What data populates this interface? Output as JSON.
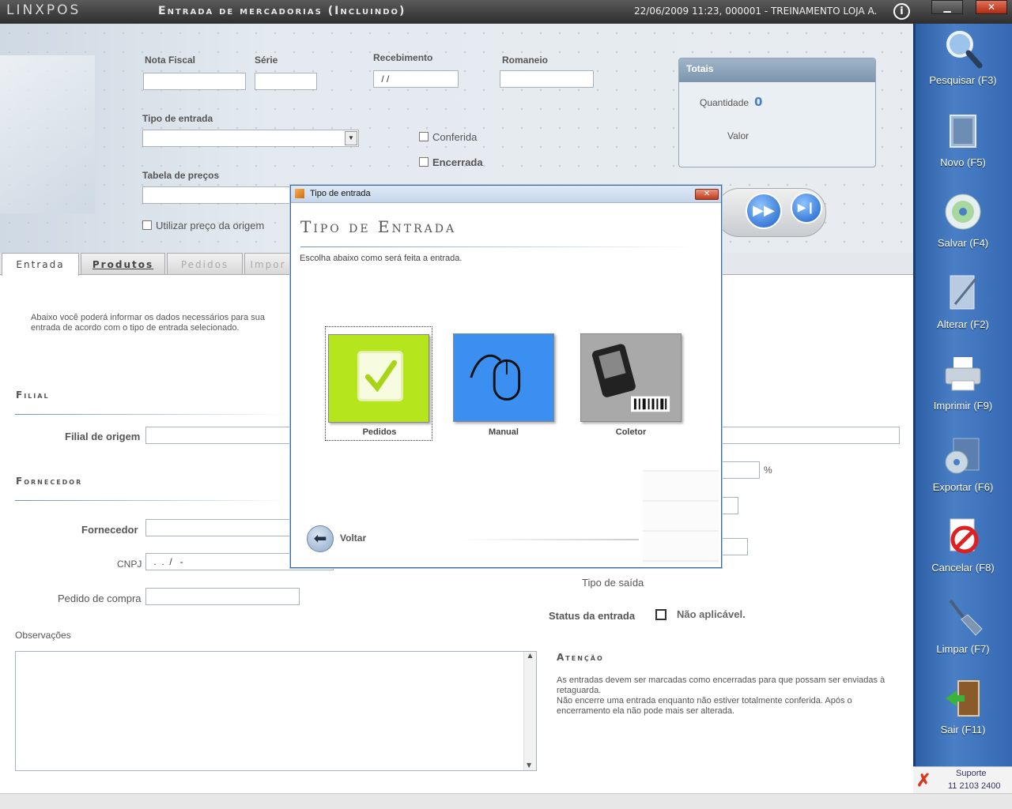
{
  "titlebar": {
    "logo": "LINXPOS",
    "title": "Entrada de mercadorias (Incluindo)",
    "session": "22/06/2009 11:23, 000001 - TREINAMENTO LOJA A.",
    "info": "i",
    "minimize": "▁",
    "close": "✕"
  },
  "form": {
    "nota_fiscal": {
      "label": "Nota Fiscal",
      "value": ""
    },
    "serie": {
      "label": "Série",
      "value": ""
    },
    "recebimento": {
      "label": "Recebimento",
      "value": " / /"
    },
    "romaneio": {
      "label": "Romaneio",
      "value": ""
    },
    "tipo_entrada": {
      "label": "Tipo de entrada",
      "value": ""
    },
    "conferida": "Conferida",
    "encerrada": "Encerrada",
    "tabela_precos": {
      "label": "Tabela de preços",
      "value": ""
    },
    "utilizar_preco": "Utilizar preço da origem"
  },
  "totais": {
    "title": "Totais",
    "quantidade_label": "Quantidade",
    "quantidade_value": "0",
    "valor_label": "Valor"
  },
  "tabs": [
    {
      "label": "Entrada",
      "state": "active"
    },
    {
      "label": "Produtos",
      "state": "normal"
    },
    {
      "label": "Pedidos",
      "state": "disabled"
    },
    {
      "label": "Impor",
      "state": "disabled"
    }
  ],
  "main": {
    "intro": "Abaixo você poderá informar os dados necessários para sua entrada de acordo com o tipo de entrada selecionado.",
    "filial_section": "Filial",
    "filial_origem_label": "Filial de origem",
    "fornecedor_section": "Fornecedor",
    "fornecedor_label": "Fornecedor",
    "cnpj_label": "CNPJ",
    "cnpj_value": " .  .  /   -",
    "pedido_compra_label": "Pedido de compra",
    "observacoes_label": "Observações",
    "percent": "%",
    "tipo_saida_label": "Tipo de saída",
    "status_label": "Status da entrada",
    "status_value": "Não aplicável.",
    "atencao_title": "Atenção",
    "atencao_text1": "As entradas devem ser marcadas como encerradas para que possam ser enviadas à retaguarda.",
    "atencao_text2": "Não encerre uma entrada enquanto não estiver totalmente conferida. Após o encerramento ela não pode mais ser alterada."
  },
  "sidebar": [
    {
      "label": "Pesquisar (F3)",
      "icon": "search-icon"
    },
    {
      "label": "Novo (F5)",
      "icon": "new-icon"
    },
    {
      "label": "Salvar (F4)",
      "icon": "save-disc-icon"
    },
    {
      "label": "Alterar (F2)",
      "icon": "edit-icon"
    },
    {
      "label": "Imprimir (F9)",
      "icon": "printer-icon"
    },
    {
      "label": "Exportar (F6)",
      "icon": "export-icon"
    },
    {
      "label": "Cancelar (F8)",
      "icon": "cancel-icon"
    },
    {
      "label": "Limpar (F7)",
      "icon": "broom-icon"
    },
    {
      "label": "Sair (F11)",
      "icon": "exit-door-icon"
    }
  ],
  "suporte": {
    "label": "Suporte",
    "phone": "11 2103 2400"
  },
  "dialog": {
    "window_title": "Tipo de entrada",
    "heading": "Tipo de Entrada",
    "subtitle": "Escolha abaixo como será feita a entrada.",
    "options": [
      {
        "label": "Pedidos",
        "icon": "notepad-check-icon",
        "color": "#b5e61d"
      },
      {
        "label": "Manual",
        "icon": "mouse-icon",
        "color": "#3a8ff0"
      },
      {
        "label": "Coletor",
        "icon": "pda-barcode-icon",
        "color": "#a9a9a9"
      }
    ],
    "back_label": "Voltar"
  },
  "colors": {
    "sidebar": "#3568b2",
    "titlebar": "#3a3a3a",
    "accent": "#6b93c0"
  }
}
